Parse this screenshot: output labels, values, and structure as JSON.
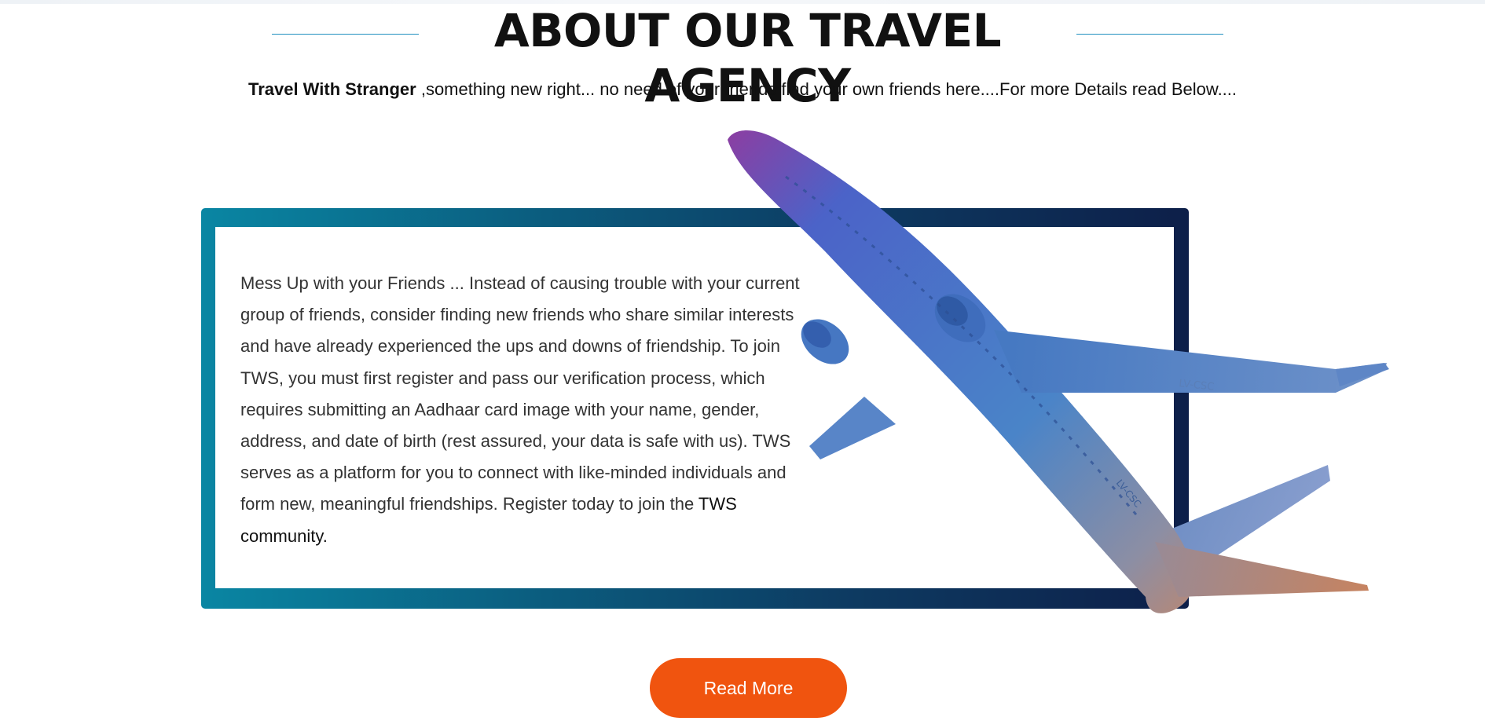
{
  "header": {
    "title": "ABOUT OUR TRAVEL AGENCY"
  },
  "intro": {
    "brand": "Travel With Stranger",
    "text": " ,something new right... no need of your friends find your own friends here....For more Details read Below...."
  },
  "about": {
    "paragraph": "Mess Up with your Friends ... Instead of causing trouble with your current group of friends, consider finding new friends who share similar interests and have already experienced the ups and downs of friendship. To join TWS, you must first register and pass our verification process, which requires submitting an Aadhaar card image with your name, gender, address, and date of birth (rest assured, your data is safe with us). TWS serves as a platform for you to connect with like-minded individuals and form new, meaningful friendships. Register today to join the",
    "emphasis": "TWS community."
  },
  "airplane": {
    "registration_tail": "LV-CSC",
    "registration_wing": "LV-CSC"
  },
  "cta": {
    "read_more_label": "Read More"
  },
  "colors": {
    "accent_orange": "#f0540f",
    "frame_start": "#0a86a3",
    "frame_end": "#0d1f49",
    "heading_line": "#1f8fbf"
  }
}
